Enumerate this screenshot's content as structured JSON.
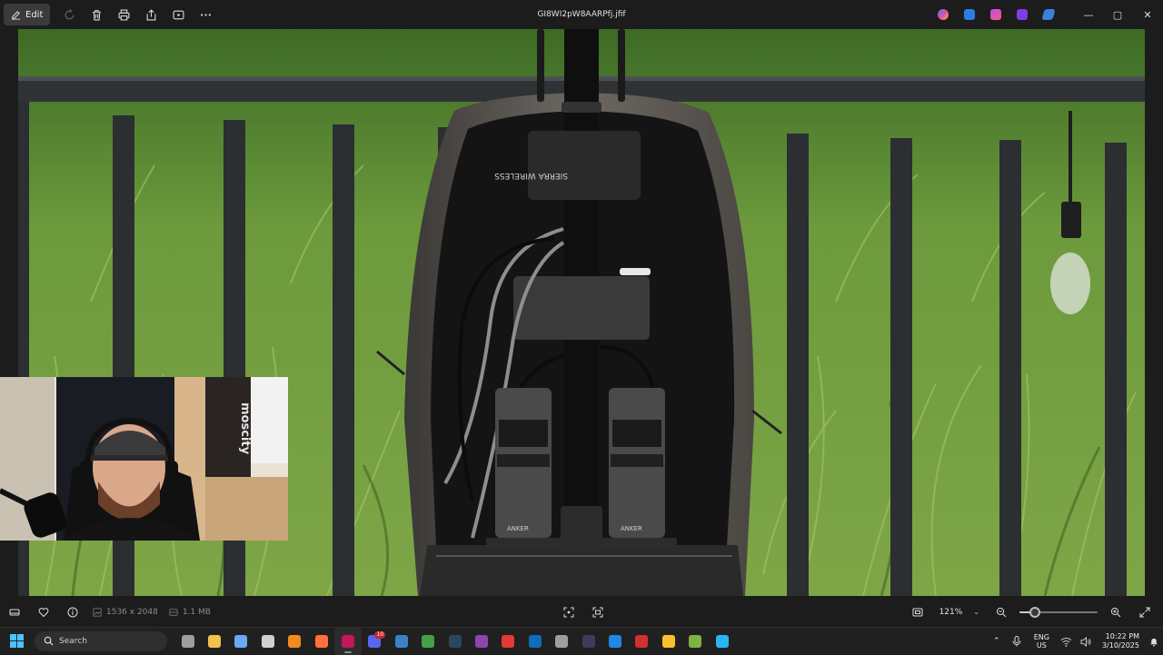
{
  "titlebar": {
    "edit_label": "Edit",
    "filename": "GI8WI2pW8AARPfj.jfif",
    "toolbar_icons": [
      "rotate-icon",
      "delete-icon",
      "print-icon",
      "share-icon",
      "slideshow-icon",
      "more-icon"
    ],
    "app_icons": [
      "copilot-icon",
      "editor-icon",
      "generative-erase-icon",
      "designer-icon",
      "clipchamp-icon"
    ],
    "window_controls": {
      "minimize": "—",
      "maximize": "▢",
      "close": "✕"
    }
  },
  "infobar": {
    "dimensions": "1536 x 2048",
    "file_size": "1.1 MB",
    "zoom_level": "121%",
    "zoom_fraction": 0.2
  },
  "taskbar": {
    "search_placeholder": "Search",
    "apps": [
      {
        "name": "task-view-icon",
        "color": "#9e9e9e"
      },
      {
        "name": "file-explorer-icon",
        "color": "#f2c14e"
      },
      {
        "name": "copilot-icon",
        "color": "#6aa9f4"
      },
      {
        "name": "obs-icon",
        "color": "#d0d0d0"
      },
      {
        "name": "vlc-icon",
        "color": "#f28a1e"
      },
      {
        "name": "firefox-icon",
        "color": "#ff7139"
      },
      {
        "name": "photos-icon",
        "color": "#c2185b"
      },
      {
        "name": "discord-icon",
        "color": "#5865f2"
      },
      {
        "name": "vscode-icon",
        "color": "#3b82c4"
      },
      {
        "name": "maps-icon",
        "color": "#43a047"
      },
      {
        "name": "steam-icon",
        "color": "#2a475e"
      },
      {
        "name": "app-purple-icon",
        "color": "#8e44ad"
      },
      {
        "name": "app-red-icon",
        "color": "#e53935"
      },
      {
        "name": "outlook-icon",
        "color": "#0f6cbd"
      },
      {
        "name": "shield-icon",
        "color": "#9e9e9e"
      },
      {
        "name": "terminal-icon",
        "color": "#3c3c5c"
      },
      {
        "name": "app-blue-icon",
        "color": "#1e88e5"
      },
      {
        "name": "app-red-circle-icon",
        "color": "#d32f2f"
      },
      {
        "name": "chrome-icon",
        "color": "#fbc02d"
      },
      {
        "name": "notepad-icon",
        "color": "#7cb342"
      },
      {
        "name": "snipping-icon",
        "color": "#29b6f6"
      }
    ],
    "active_app_index": 6,
    "discord_badge": "10",
    "lang_top": "ENG",
    "lang_bottom": "US",
    "time": "10:22 PM",
    "date": "3/10/2025"
  },
  "photo": {
    "pack_brand": "SIERRA WIRELESS",
    "battery_left_label": "ANKER",
    "battery_right_label": "ANKER"
  },
  "webcam": {
    "poster_text": "moscity"
  }
}
